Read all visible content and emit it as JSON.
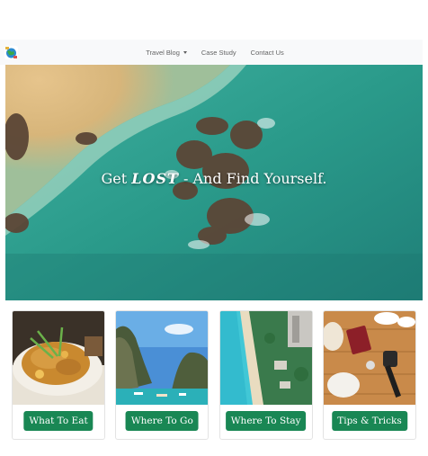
{
  "navbar": {
    "logo_icon": "globe-logo-icon",
    "items": [
      {
        "label": "Travel Blog",
        "dropdown": true
      },
      {
        "label": "Case Study",
        "dropdown": false
      },
      {
        "label": "Contact Us",
        "dropdown": false
      }
    ]
  },
  "hero": {
    "title_before": "Get ",
    "title_accent": "LOST",
    "title_after": " - And Find Yourself.",
    "image": "aerial-beach-rocks"
  },
  "cards": [
    {
      "image": "food-noodles-photo",
      "button_label": "What To Eat"
    },
    {
      "image": "island-cliffs-photo",
      "button_label": "Where To Go"
    },
    {
      "image": "beach-resort-aerial-photo",
      "button_label": "Where To Stay"
    },
    {
      "image": "travel-gear-flatlay-photo",
      "button_label": "Tips & Tricks"
    }
  ],
  "colors": {
    "navbar_bg": "#f8f9fa",
    "button_green": "#198754",
    "sea": "#2f9c8a",
    "sand": "#d8b47c"
  }
}
